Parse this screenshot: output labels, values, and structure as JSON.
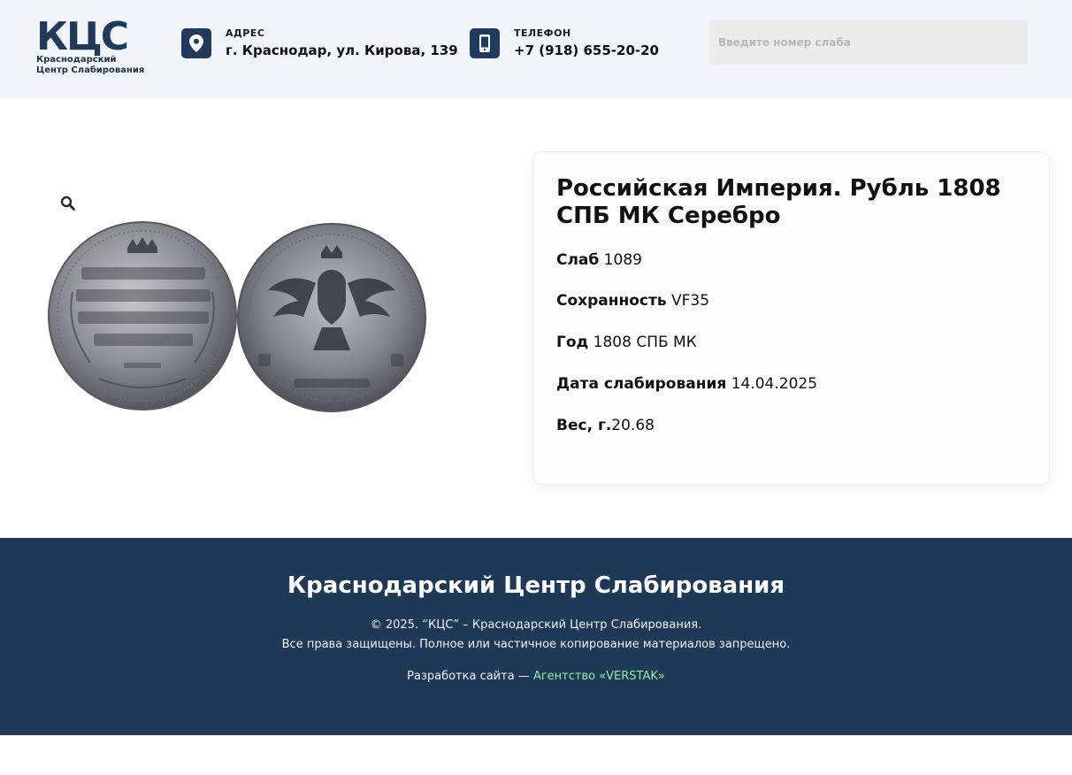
{
  "header": {
    "logo_mark": "КЦС",
    "logo_sub_line1": "Краснодарский",
    "logo_sub_line2": "Центр Слабирования",
    "address_label": "АДРЕС",
    "address_value": "г. Краснодар, ул. Кирова, 139",
    "phone_label": "ТЕЛЕФОН",
    "phone_value": "+7 (918) 655-20-20",
    "search_placeholder": "Введите номер слаба",
    "icon_address": "map-pin-icon",
    "icon_phone": "smartphone-icon"
  },
  "product": {
    "title": "Российская Империя. Рубль 1808 СПБ МК Серебро",
    "zoom_icon": "magnifier-icon",
    "details": [
      {
        "label": "Слаб",
        "value": " 1089"
      },
      {
        "label": "Сохранность",
        "value": " VF35"
      },
      {
        "label": "Год",
        "value": " 1808 СПБ МК"
      },
      {
        "label": "Дата слабирования",
        "value": " 14.04.2025"
      },
      {
        "label": "Вес, г.",
        "value": "20.68"
      }
    ]
  },
  "footer": {
    "title": "Краснодарский Центр Слабирования",
    "copyright": "© 2025. “КЦС” – Краснодарский Центр Слабирования.",
    "rights": "Все права защищены. Полное или частичное копирование материалов запрещено.",
    "dev_prefix": "Разработка сайта — ",
    "dev_link": "Агентство «VERSTAK»"
  },
  "colors": {
    "brand": "#1f3a5a",
    "footer_bg": "#1f3a57",
    "link": "#8ff09c",
    "header_bg": "#f1f5fa"
  }
}
